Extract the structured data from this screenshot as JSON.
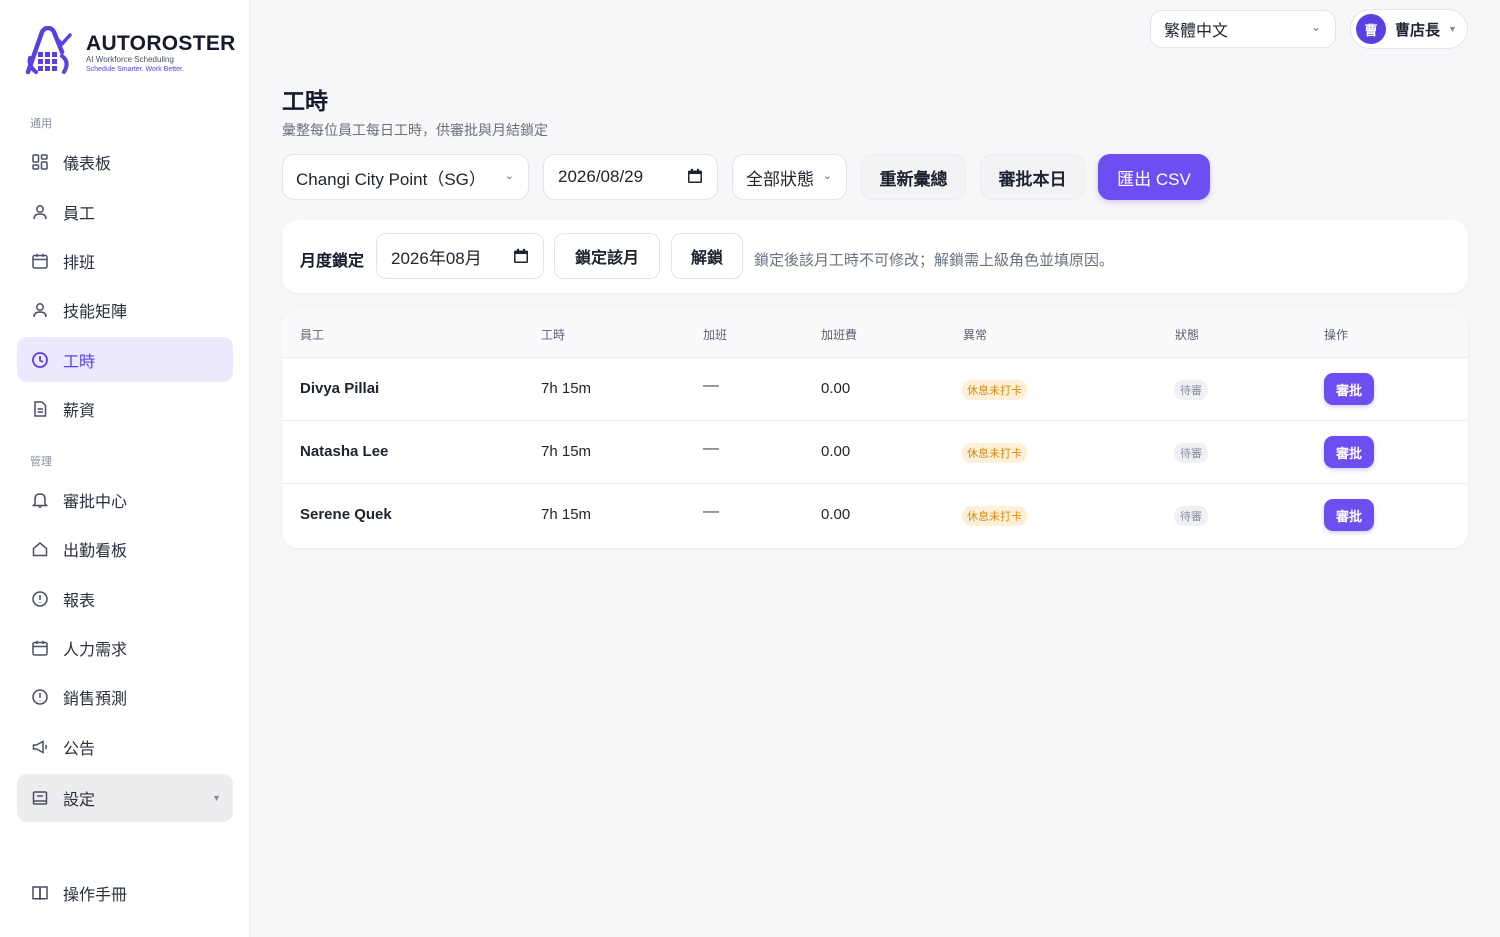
{
  "brand": {
    "name": "AUTOROSTER",
    "tagline1": "AI Workforce Scheduling",
    "tagline2": "Schedule Smarter. Work Better.",
    "accent": "#5b3fe0"
  },
  "sidebar": {
    "section_general": "通用",
    "section_admin": "管理",
    "general_items": [
      {
        "label": "儀表板",
        "icon": "grid-icon"
      },
      {
        "label": "員工",
        "icon": "user-icon"
      },
      {
        "label": "排班",
        "icon": "calendar-icon"
      },
      {
        "label": "技能矩陣",
        "icon": "user-icon"
      },
      {
        "label": "工時",
        "icon": "clock-icon",
        "active": true
      },
      {
        "label": "薪資",
        "icon": "document-icon"
      }
    ],
    "admin_items": [
      {
        "label": "審批中心",
        "icon": "bell-icon"
      },
      {
        "label": "出勤看板",
        "icon": "home-icon"
      },
      {
        "label": "報表",
        "icon": "alert-circle-icon"
      },
      {
        "label": "人力需求",
        "icon": "calendar-icon"
      },
      {
        "label": "銷售預測",
        "icon": "alert-circle-icon"
      },
      {
        "label": "公告",
        "icon": "megaphone-icon"
      },
      {
        "label": "設定",
        "icon": "store-icon"
      }
    ],
    "manual": "操作手冊"
  },
  "header": {
    "language": "繁體中文",
    "user_initial": "曹",
    "user_name": "曹店長"
  },
  "page": {
    "title": "工時",
    "subtitle": "彙整每位員工每日工時，供審批與月結鎖定"
  },
  "toolbar": {
    "store": "Changi City Point（SG）",
    "date": "2026/08/29",
    "status_filter": "全部狀態",
    "recompute_label": "重新彙總",
    "approve_day_label": "審批本日",
    "export_label": "匯出 CSV"
  },
  "lock": {
    "label": "月度鎖定",
    "month": "2026年08月",
    "lock_button": "鎖定該月",
    "unlock_button": "解鎖",
    "note": "鎖定後該月工時不可修改；解鎖需上級角色並填原因。"
  },
  "table": {
    "headers": [
      "員工",
      "工時",
      "加班",
      "加班費",
      "異常",
      "狀態",
      "操作"
    ],
    "rows": [
      {
        "employee": "Divya Pillai",
        "hours": "7h 15m",
        "overtime": "—",
        "ot_pay": "0.00",
        "anomaly": "休息未打卡",
        "status": "待審",
        "action": "審批"
      },
      {
        "employee": "Natasha Lee",
        "hours": "7h 15m",
        "overtime": "—",
        "ot_pay": "0.00",
        "anomaly": "休息未打卡",
        "status": "待審",
        "action": "審批"
      },
      {
        "employee": "Serene Quek",
        "hours": "7h 15m",
        "overtime": "—",
        "ot_pay": "0.00",
        "anomaly": "休息未打卡",
        "status": "待審",
        "action": "審批"
      }
    ]
  }
}
